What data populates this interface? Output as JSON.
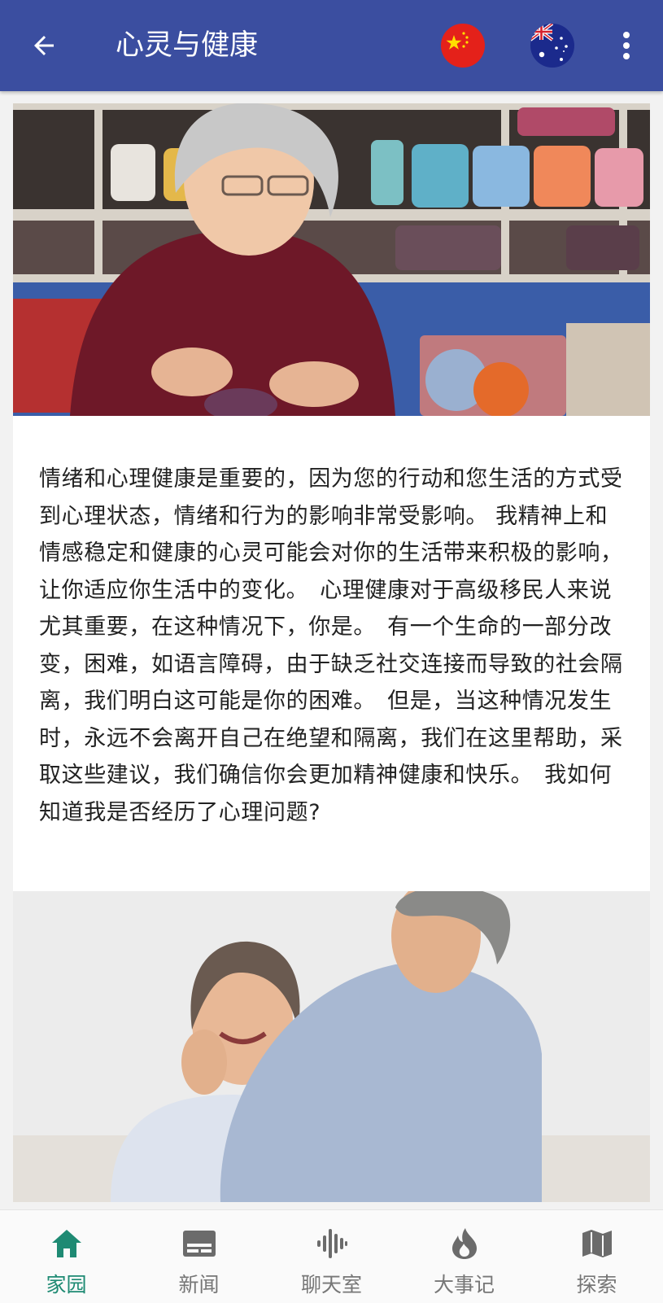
{
  "appbar": {
    "title": "心灵与健康",
    "back_icon": "arrow-left-icon",
    "menu_icon": "more-vertical-icon",
    "languages": [
      "china-flag-icon",
      "australia-flag-icon"
    ]
  },
  "article": {
    "body": "情绪和心理健康是重要的，因为您的行动和您生活的方式受到心理状态，情绪和行为的影响非常受影响。 我精神上和情感稳定和健康的心灵可能会对你的生活带来积极的影响，让你适应你生活中的变化。　心理健康对于高级移民人来说尤其重要，在这种情况下，你是。　有一个生命的一部分改变，困难，如语言障碍，由于缺乏社交连接而导致的社会隔离，我们明白这可能是你的困难。　但是，当这种情况发生时，永远不会离开自己在绝望和隔离，我们在这里帮助，采取这些建议，我们确信你会更加精神健康和快乐。　我如何知道我是否经历了心理问题?"
  },
  "bottom_nav": {
    "items": [
      {
        "label": "家园",
        "icon": "home-icon",
        "active": true
      },
      {
        "label": "新闻",
        "icon": "news-icon",
        "active": false
      },
      {
        "label": "聊天室",
        "icon": "voice-wave-icon",
        "active": false
      },
      {
        "label": "大事记",
        "icon": "flame-icon",
        "active": false
      },
      {
        "label": "探索",
        "icon": "map-icon",
        "active": false
      }
    ]
  },
  "colors": {
    "appbar": "#3b4ea0",
    "active_nav": "#1e8a73",
    "inactive_nav": "#777777"
  }
}
